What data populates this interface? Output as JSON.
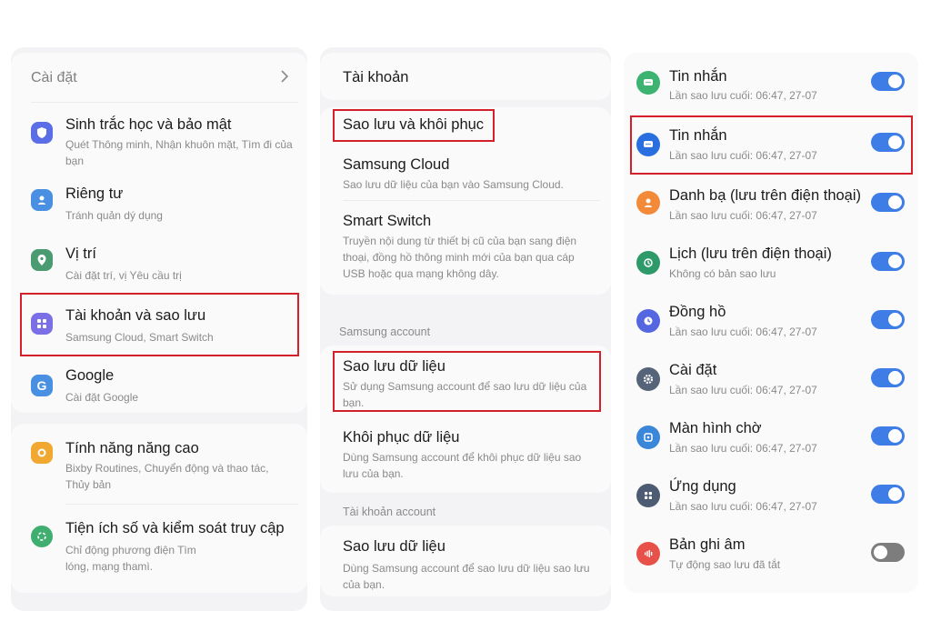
{
  "colors": {
    "highlight": "#d3202a",
    "toggle_on": "#3e7ce6",
    "toggle_off": "#7d7d7d"
  },
  "left": {
    "header": "Cài đặt",
    "header_chevron": "chevron-right-icon",
    "items": [
      {
        "title": "Sinh trắc học và bảo mật",
        "sub": "Quét Thông minh, Nhận khuôn mặt, Tìm đi của bạn",
        "icon": "shield-icon"
      },
      {
        "title": "Riêng tư",
        "sub": "Tránh quản dý dụng",
        "icon": "privacy-icon"
      },
      {
        "title": "Vị trí",
        "sub": "Cài đặt trí, vị Yêu cầu trị",
        "icon": "location-icon"
      },
      {
        "title": "Tài khoản và sao lưu",
        "sub": "Samsung Cloud, Smart Switch",
        "icon": "accounts-icon"
      },
      {
        "title": "Google",
        "sub": "Cài đặt Google",
        "icon": "google-icon"
      }
    ],
    "items2": [
      {
        "title": "Tính năng năng cao",
        "sub": "Bixby Routines, Chuyển động và thao tác, Thủy bản",
        "icon": "advanced-features-icon"
      },
      {
        "title": "Tiện ích số và kiểm soát truy cập",
        "sub": "Chỉ động phương điện Tìm lóng, mạng thamì.",
        "icon": "digital-wellbeing-icon"
      }
    ]
  },
  "middle": {
    "header": "Tài khoản",
    "items": [
      {
        "title": "Sao lưu và khôi phục",
        "sub": ""
      },
      {
        "title": "Samsung Cloud",
        "sub": "Sao lưu dữ liệu của bạn vào Samsung Cloud."
      },
      {
        "title": "Smart Switch",
        "sub": "Truyền nội dung từ thiết bị cũ của bạn sang điện thoại, đồng hồ thông minh mới của bạn qua cáp USB hoặc qua mạng không dây."
      }
    ],
    "section1": "Samsung account",
    "items2": [
      {
        "title": "Sao lưu dữ liệu",
        "sub": "Sử dụng Samsung account để sao lưu dữ liệu của bạn."
      },
      {
        "title": "Khôi phục dữ liệu",
        "sub": "Dùng Samsung account để khôi phục dữ liệu sao lưu của bạn."
      }
    ],
    "section2": "Tài khoản account",
    "items3": [
      {
        "title": "Sao lưu dữ liệu",
        "sub": "Dùng Samsung account để sao lưu dữ liệu sao lưu của bạn."
      }
    ]
  },
  "right": {
    "items": [
      {
        "title": "Tin nhắn",
        "sub": "Lần sao lưu cuối: 06:47, 27-07",
        "icon": "messages-icon",
        "on": true
      },
      {
        "title": "Tin nhắn",
        "sub": "Lần sao lưu cuối: 06:47, 27-07",
        "icon": "messages-icon",
        "on": true
      },
      {
        "title": "Danh bạ (lưu trên điện thoại)",
        "sub": "Lần sao lưu cuối: 06:47, 27-07",
        "icon": "contacts-icon",
        "on": true
      },
      {
        "title": "Lịch (lưu trên điện thoại)",
        "sub": "Không có bản sao lưu",
        "icon": "calendar-icon",
        "on": true
      },
      {
        "title": "Đồng hồ",
        "sub": "Lần sao lưu cuối: 06:47, 27-07",
        "icon": "clock-icon",
        "on": true
      },
      {
        "title": "Cài đặt",
        "sub": "Lần sao lưu cuối: 06:47, 27-07",
        "icon": "settings-icon",
        "on": true
      },
      {
        "title": "Màn hình chờ",
        "sub": "Lần sao lưu cuối: 06:47, 27-07",
        "icon": "home-screen-icon",
        "on": true
      },
      {
        "title": "Ứng dụng",
        "sub": "Lần sao lưu cuối: 06:47, 27-07",
        "icon": "apps-icon",
        "on": true
      },
      {
        "title": "Bản ghi âm",
        "sub": "Tự động sao lưu đã tắt",
        "icon": "voice-recorder-icon",
        "on": false
      }
    ]
  }
}
